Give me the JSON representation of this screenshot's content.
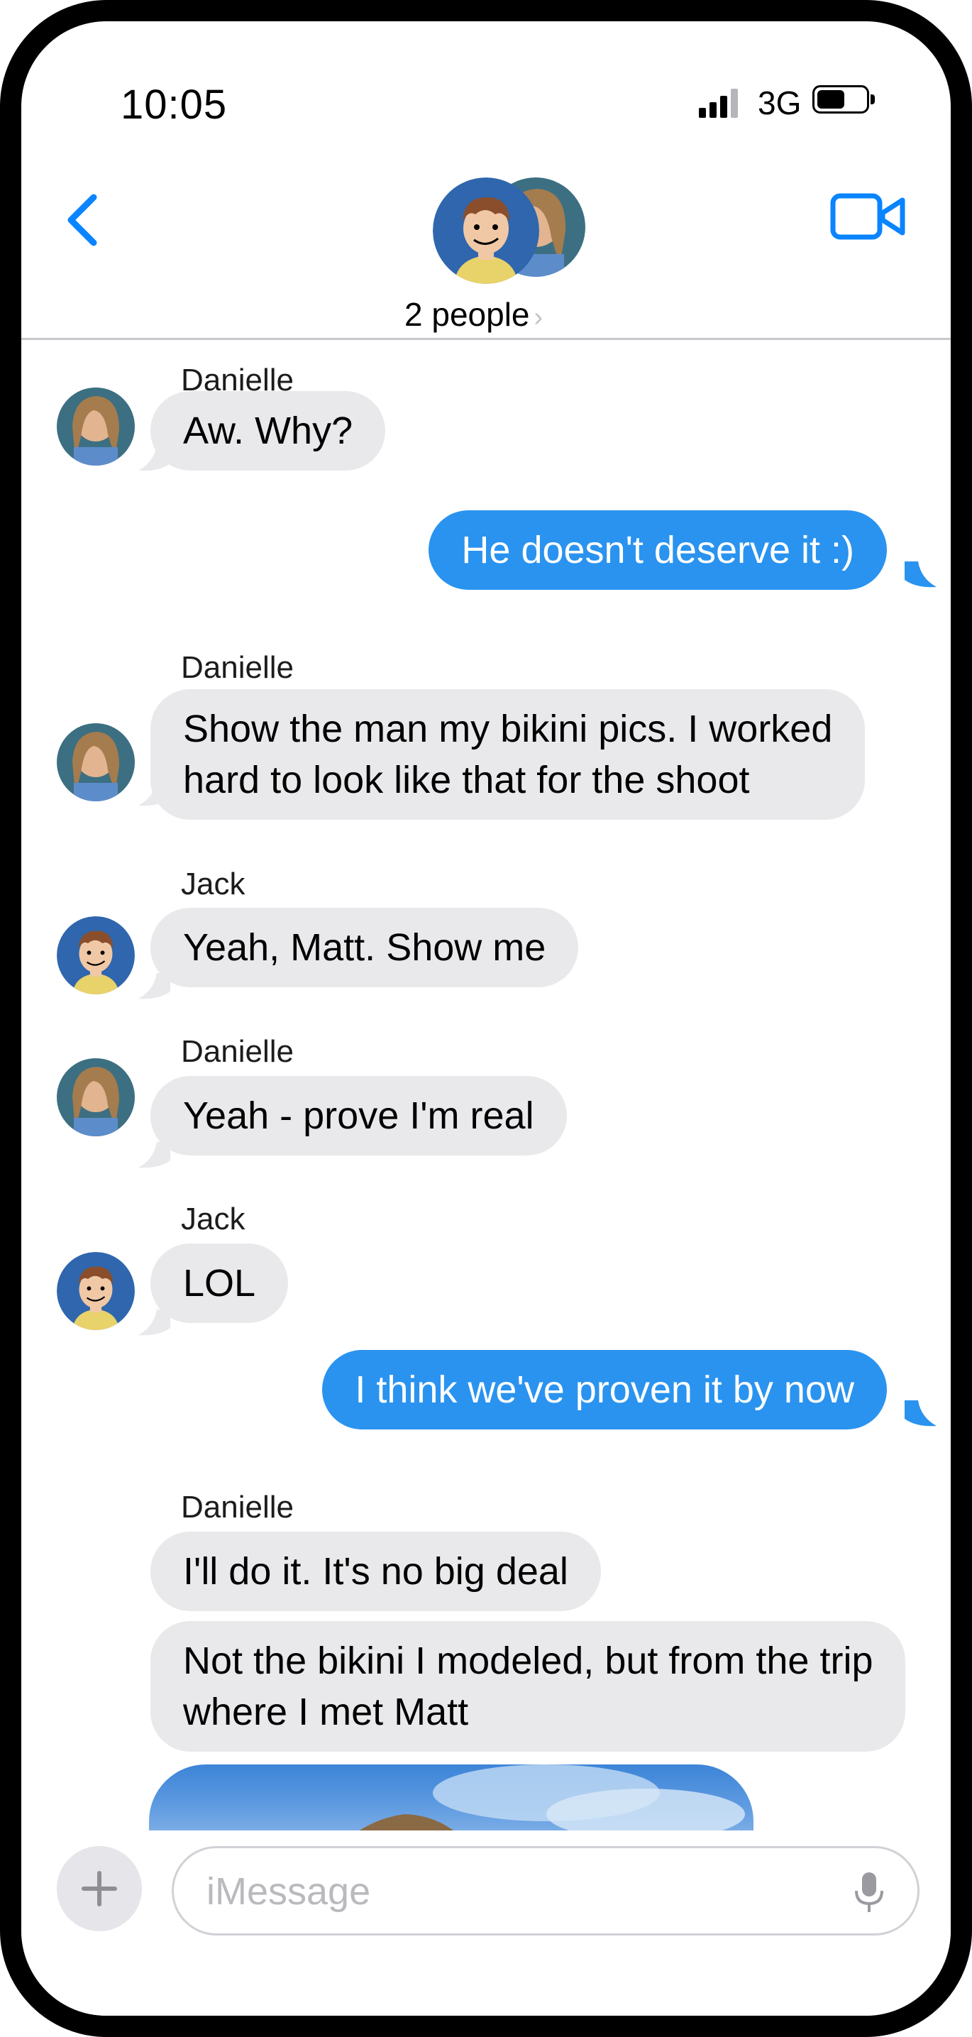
{
  "status_bar": {
    "time": "10:05",
    "network": "3G",
    "icons": [
      "signal-bars-icon",
      "battery-icon"
    ]
  },
  "header": {
    "people_label": "2 people",
    "chevron": "›",
    "icons": [
      "back-chevron-icon",
      "video-call-icon"
    ]
  },
  "messages": [
    {
      "sender": "Danielle",
      "text": "Aw.  Why?",
      "direction": "incoming"
    },
    {
      "sender": "",
      "text": "He doesn't deserve it :)",
      "direction": "outgoing"
    },
    {
      "sender": "Danielle",
      "lines": [
        "Show the man my bikini pics.  I worked",
        "hard to look like that for the shoot"
      ],
      "direction": "incoming"
    },
    {
      "sender": "Jack",
      "text": "Yeah, Matt.  Show me",
      "direction": "incoming"
    },
    {
      "sender": "Danielle",
      "text": "Yeah - prove I'm real",
      "direction": "incoming"
    },
    {
      "sender": "Jack",
      "text": "LOL",
      "direction": "incoming"
    },
    {
      "sender": "",
      "text": "I think we've proven it by now",
      "direction": "outgoing"
    },
    {
      "sender": "Danielle",
      "text": "I'll do it.  It's no big deal",
      "direction": "incoming"
    },
    {
      "sender": "Danielle",
      "lines": [
        "Not the bikini I modeled, but from the trip",
        "where I met Matt"
      ],
      "direction": "incoming"
    },
    {
      "sender": "Danielle",
      "attachment": "photo",
      "direction": "incoming"
    }
  ],
  "compose": {
    "placeholder": "iMessage",
    "value": "",
    "icons": [
      "plus-icon",
      "microphone-icon"
    ]
  },
  "colors": {
    "accent": "#0a84ff",
    "outgoing_bubble": "#2a93ef",
    "incoming_bubble": "#e9e9eb"
  }
}
